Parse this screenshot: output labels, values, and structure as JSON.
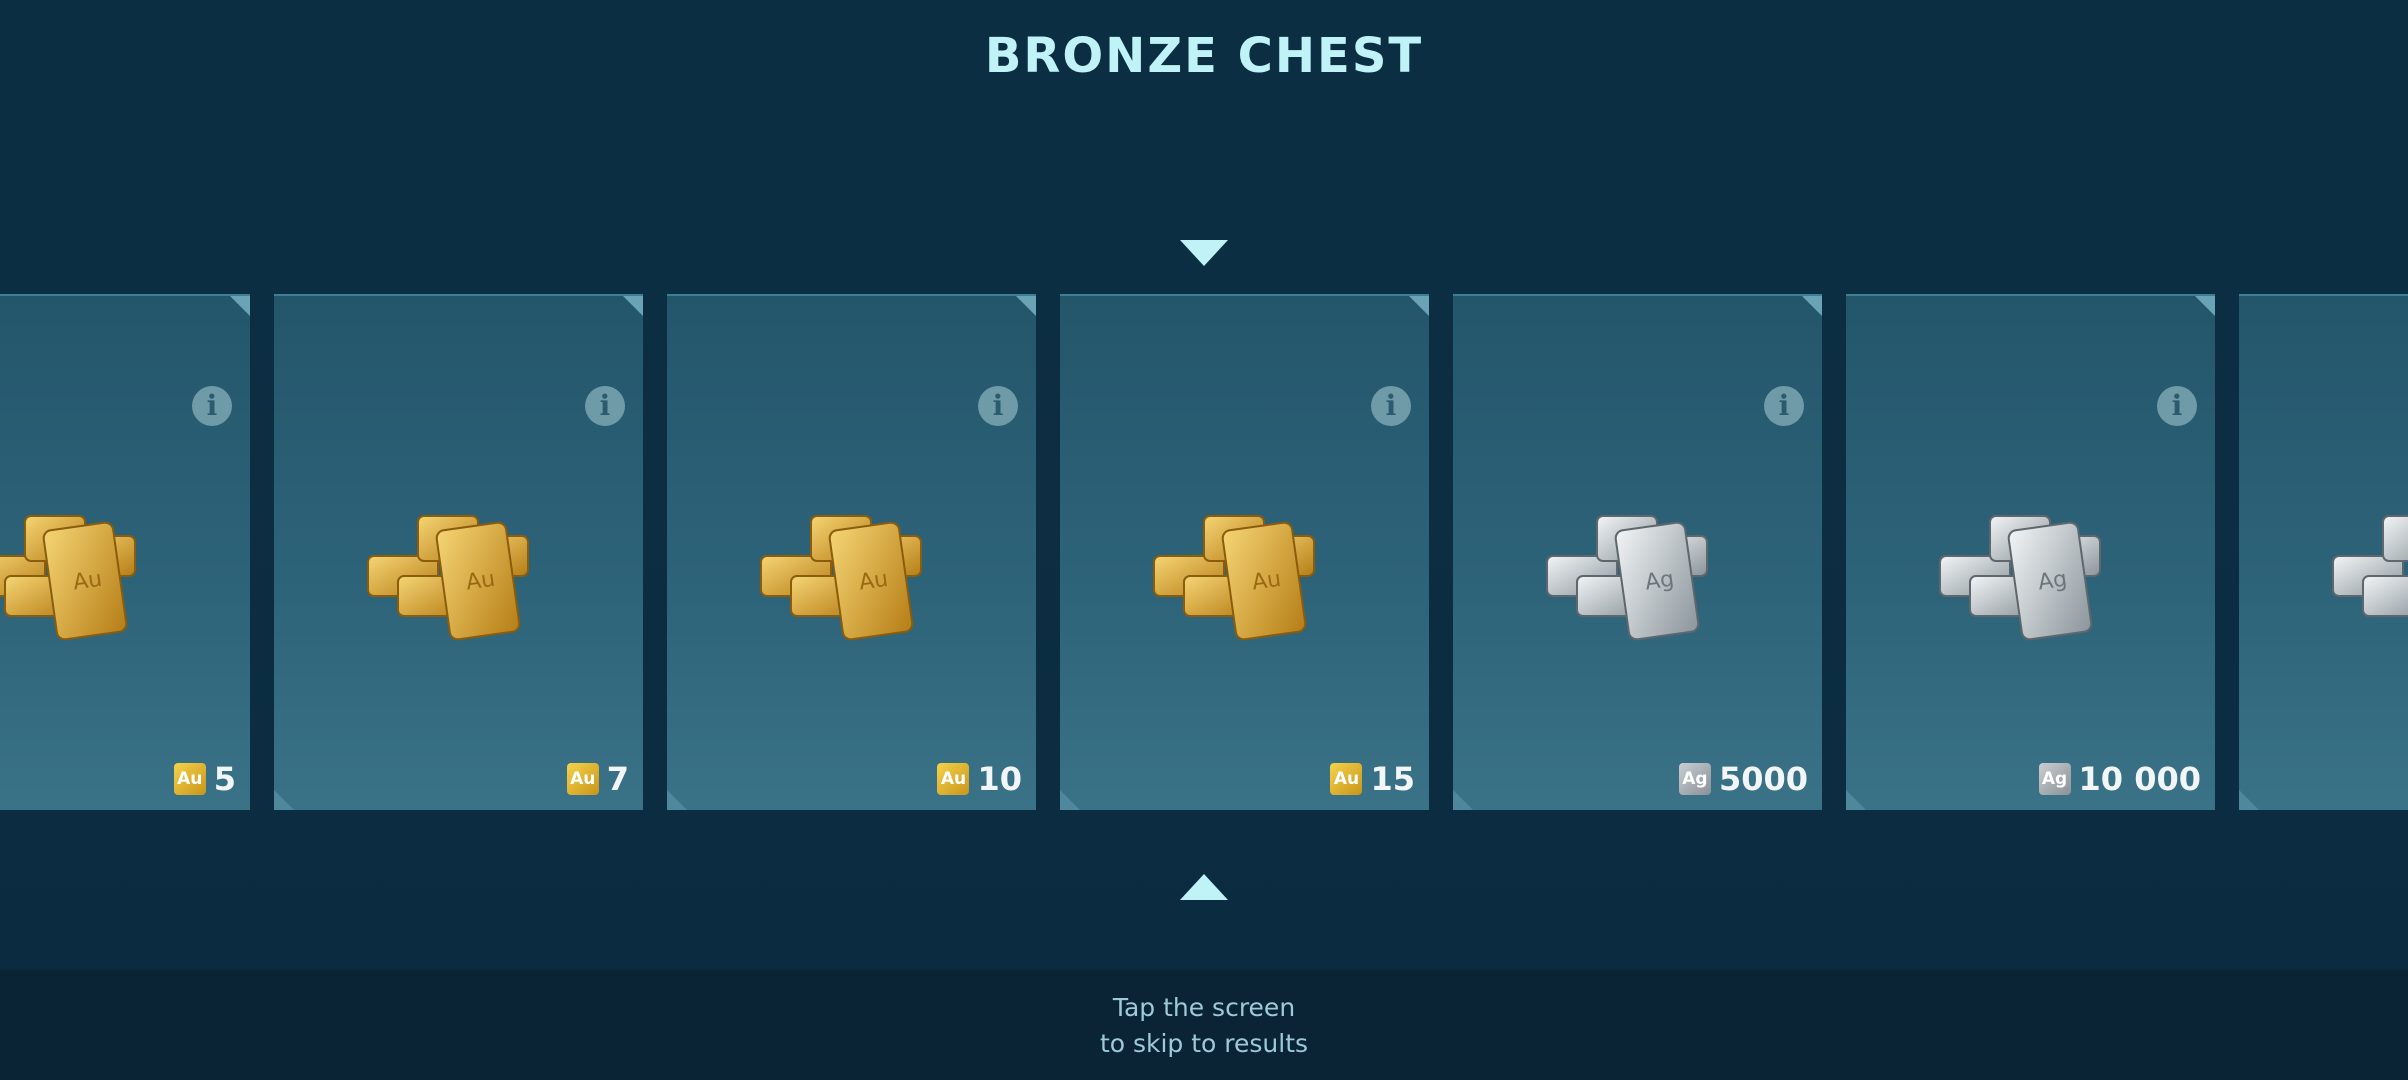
{
  "title": "BRONZE CHEST",
  "hint": {
    "line1": "Tap the screen",
    "line2": "to skip to results"
  },
  "colors": {
    "background": "#0b2d41",
    "title": "#bff3f7",
    "card": "#2d6379",
    "gold": "#d8a32a",
    "silver": "#b7bec3"
  },
  "cards": [
    {
      "metal": "gold",
      "badge": "Au",
      "amount": "5"
    },
    {
      "metal": "gold",
      "badge": "Au",
      "amount": "7"
    },
    {
      "metal": "gold",
      "badge": "Au",
      "amount": "10"
    },
    {
      "metal": "gold",
      "badge": "Au",
      "amount": "15"
    },
    {
      "metal": "silver",
      "badge": "Ag",
      "amount": "5000"
    },
    {
      "metal": "silver",
      "badge": "Ag",
      "amount": "10 000"
    },
    {
      "metal": "silver",
      "badge": "",
      "amount": ""
    }
  ],
  "icons": {
    "marker_top": "triangle-down-icon",
    "marker_bottom": "triangle-up-icon",
    "info": "info-icon"
  }
}
